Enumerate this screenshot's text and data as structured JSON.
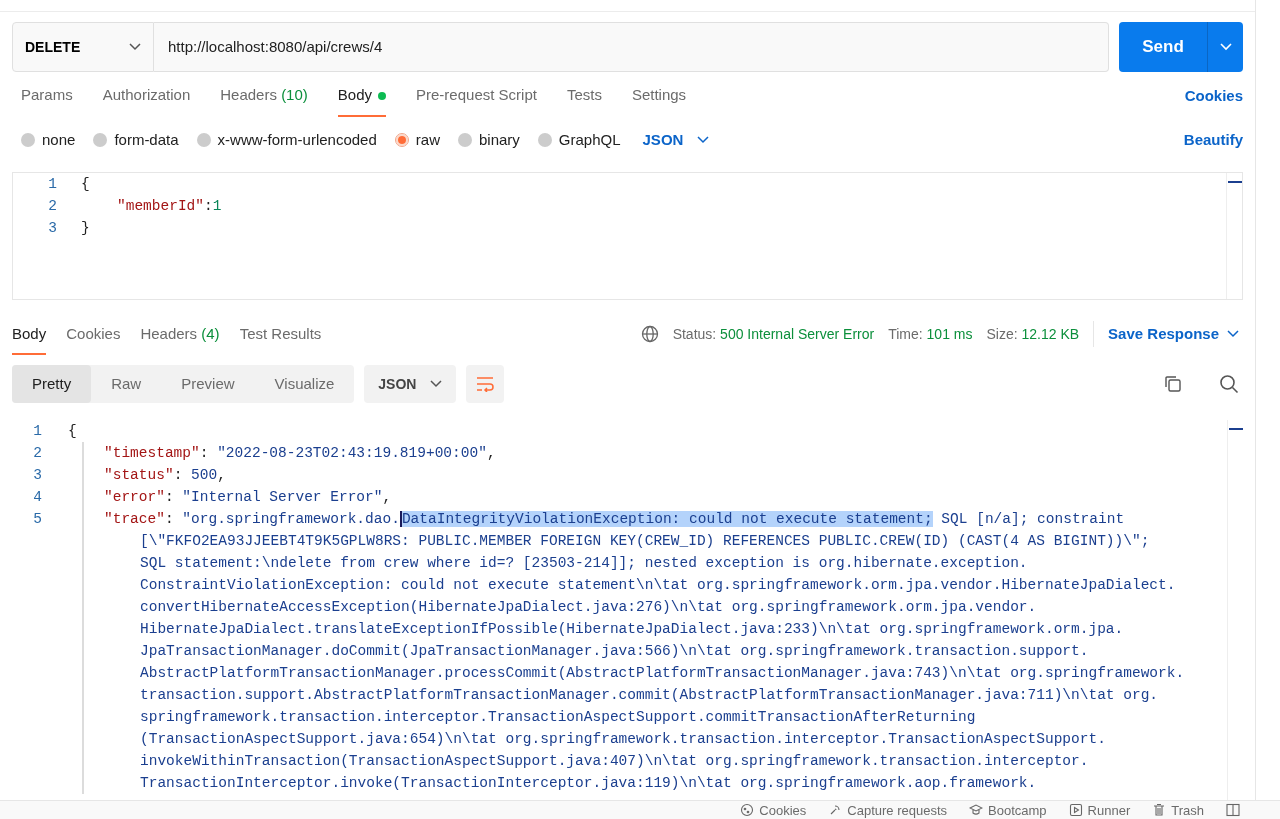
{
  "request": {
    "method": "DELETE",
    "url": "http://localhost:8080/api/crews/4",
    "send_label": "Send"
  },
  "request_tabs": [
    {
      "label": "Params",
      "dot": false,
      "selected": false
    },
    {
      "label": "Authorization",
      "dot": false,
      "selected": false
    },
    {
      "label": "Headers",
      "count": "(10)",
      "dot": false,
      "selected": false
    },
    {
      "label": "Body",
      "dot": true,
      "selected": true
    },
    {
      "label": "Pre-request Script",
      "dot": false,
      "selected": false
    },
    {
      "label": "Tests",
      "dot": false,
      "selected": false
    },
    {
      "label": "Settings",
      "dot": false,
      "selected": false
    }
  ],
  "cookies_link": "Cookies",
  "body_types": [
    {
      "label": "none",
      "selected": false
    },
    {
      "label": "form-data",
      "selected": false
    },
    {
      "label": "x-www-form-urlencoded",
      "selected": false
    },
    {
      "label": "raw",
      "selected": true
    },
    {
      "label": "binary",
      "selected": false
    },
    {
      "label": "GraphQL",
      "selected": false
    }
  ],
  "body_format": "JSON",
  "beautify_link": "Beautify",
  "request_body": [
    {
      "number": "1",
      "kind": "punct",
      "text": "{"
    },
    {
      "number": "2",
      "kind": "pair",
      "key": "\"memberId\"",
      "sep": ":",
      "value": "1"
    },
    {
      "number": "3",
      "kind": "punct",
      "text": "}"
    }
  ],
  "response_tabs": [
    {
      "label": "Body",
      "selected": true
    },
    {
      "label": "Cookies",
      "selected": false
    },
    {
      "label": "Headers",
      "count": "(4)",
      "selected": false
    },
    {
      "label": "Test Results",
      "selected": false
    }
  ],
  "response_meta": [
    {
      "label": "Status:",
      "value": "500 Internal Server Error"
    },
    {
      "label": "Time:",
      "value": "101 ms"
    },
    {
      "label": "Size:",
      "value": "12.12 KB"
    }
  ],
  "save_response": "Save Response",
  "view_modes": [
    {
      "label": "Pretty",
      "selected": true
    },
    {
      "label": "Raw",
      "selected": false
    },
    {
      "label": "Preview",
      "selected": false
    },
    {
      "label": "Visualize",
      "selected": false
    }
  ],
  "response_format": "JSON",
  "response_body": [
    {
      "number": "1",
      "kind": "punct",
      "text": "{"
    },
    {
      "number": "2",
      "kind": "pair",
      "key": "\"timestamp\"",
      "sep": ": ",
      "value": "\"2022-08-23T02:43:19.819+00:00\"",
      "tail": ","
    },
    {
      "number": "3",
      "kind": "pair",
      "key": "\"status\"",
      "sep": ": ",
      "value": "500",
      "tail": ","
    },
    {
      "number": "4",
      "kind": "pair",
      "key": "\"error\"",
      "sep": ": ",
      "value": "\"Internal Server Error\"",
      "tail": ","
    },
    {
      "number": "5",
      "kind": "trace",
      "key": "\"trace\"",
      "sep": ": ",
      "value_start": "\"org.springframework.dao.",
      "selection": "DataIntegrityViolationException: could not execute statement;",
      "value_rest": " SQL [n/a]; constraint",
      "continuation": [
        "[\\\"FKFO2EA93JJEEBT4T9K5GPLW8RS: PUBLIC.MEMBER FOREIGN KEY(CREW_ID) REFERENCES PUBLIC.CREW(ID) (CAST(4 AS BIGINT))\\\";",
        "SQL statement:\\ndelete from crew where id=? [23503-214]]; nested exception is org.hibernate.exception.",
        "ConstraintViolationException: could not execute statement\\n\\tat org.springframework.orm.jpa.vendor.HibernateJpaDialect.",
        "convertHibernateAccessException(HibernateJpaDialect.java:276)\\n\\tat org.springframework.orm.jpa.vendor.",
        "HibernateJpaDialect.translateExceptionIfPossible(HibernateJpaDialect.java:233)\\n\\tat org.springframework.orm.jpa.",
        "JpaTransactionManager.doCommit(JpaTransactionManager.java:566)\\n\\tat org.springframework.transaction.support.",
        "AbstractPlatformTransactionManager.processCommit(AbstractPlatformTransactionManager.java:743)\\n\\tat org.springframework.",
        "transaction.support.AbstractPlatformTransactionManager.commit(AbstractPlatformTransactionManager.java:711)\\n\\tat org.",
        "springframework.transaction.interceptor.TransactionAspectSupport.commitTransactionAfterReturning",
        "(TransactionAspectSupport.java:654)\\n\\tat org.springframework.transaction.interceptor.TransactionAspectSupport.",
        "invokeWithinTransaction(TransactionAspectSupport.java:407)\\n\\tat org.springframework.transaction.interceptor.",
        "TransactionInterceptor.invoke(TransactionInterceptor.java:119)\\n\\tat org.springframework.aop.framework."
      ]
    }
  ],
  "status_bar": [
    {
      "label": "Cookies"
    },
    {
      "label": "Capture requests"
    },
    {
      "label": "Bootcamp"
    },
    {
      "label": "Runner"
    },
    {
      "label": "Trash"
    }
  ]
}
